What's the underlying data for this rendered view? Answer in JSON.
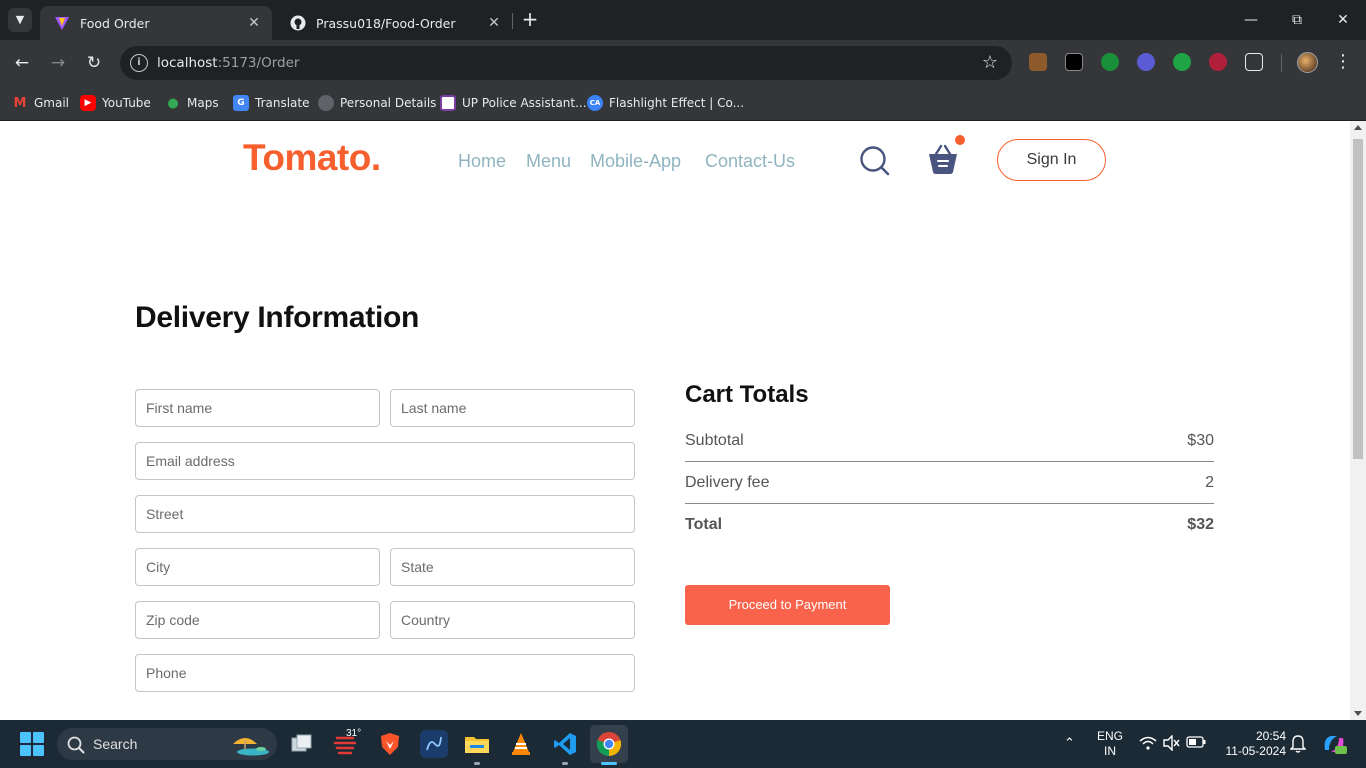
{
  "browser": {
    "tabs": [
      {
        "title": "Food Order",
        "active": true,
        "favicon": "vite-icon"
      },
      {
        "title": "Prassu018/Food-Order",
        "active": false,
        "favicon": "github-icon"
      }
    ],
    "url_host": "localhost",
    "url_path": ":5173/Order",
    "bookmarks": [
      "Gmail",
      "YouTube",
      "Maps",
      "Translate",
      "Personal Details",
      "UP Police Assistant...",
      "Flashlight Effect | Co..."
    ]
  },
  "site": {
    "logo": "Tomato.",
    "nav": [
      "Home",
      "Menu",
      "Mobile-App",
      "Contact-Us"
    ],
    "signin_label": "Sign In",
    "brand_color": "#f75f2e",
    "nav_color": "#8fb4c0"
  },
  "delivery": {
    "heading": "Delivery Information",
    "placeholders": {
      "first_name": "First name",
      "last_name": "Last name",
      "email": "Email address",
      "street": "Street",
      "city": "City",
      "state": "State",
      "zip": "Zip code",
      "country": "Country",
      "phone": "Phone"
    }
  },
  "cart": {
    "heading": "Cart Totals",
    "rows": [
      {
        "label": "Subtotal",
        "value": "$30"
      },
      {
        "label": "Delivery fee",
        "value": "2"
      },
      {
        "label": "Total",
        "value": "$32"
      }
    ],
    "button_label": "Proceed to Payment",
    "button_color": "#f9634c"
  },
  "taskbar": {
    "search_label": "Search",
    "weather_temp": "31°",
    "lang_primary": "ENG",
    "lang_secondary": "IN",
    "time": "20:54",
    "date": "11-05-2024"
  }
}
